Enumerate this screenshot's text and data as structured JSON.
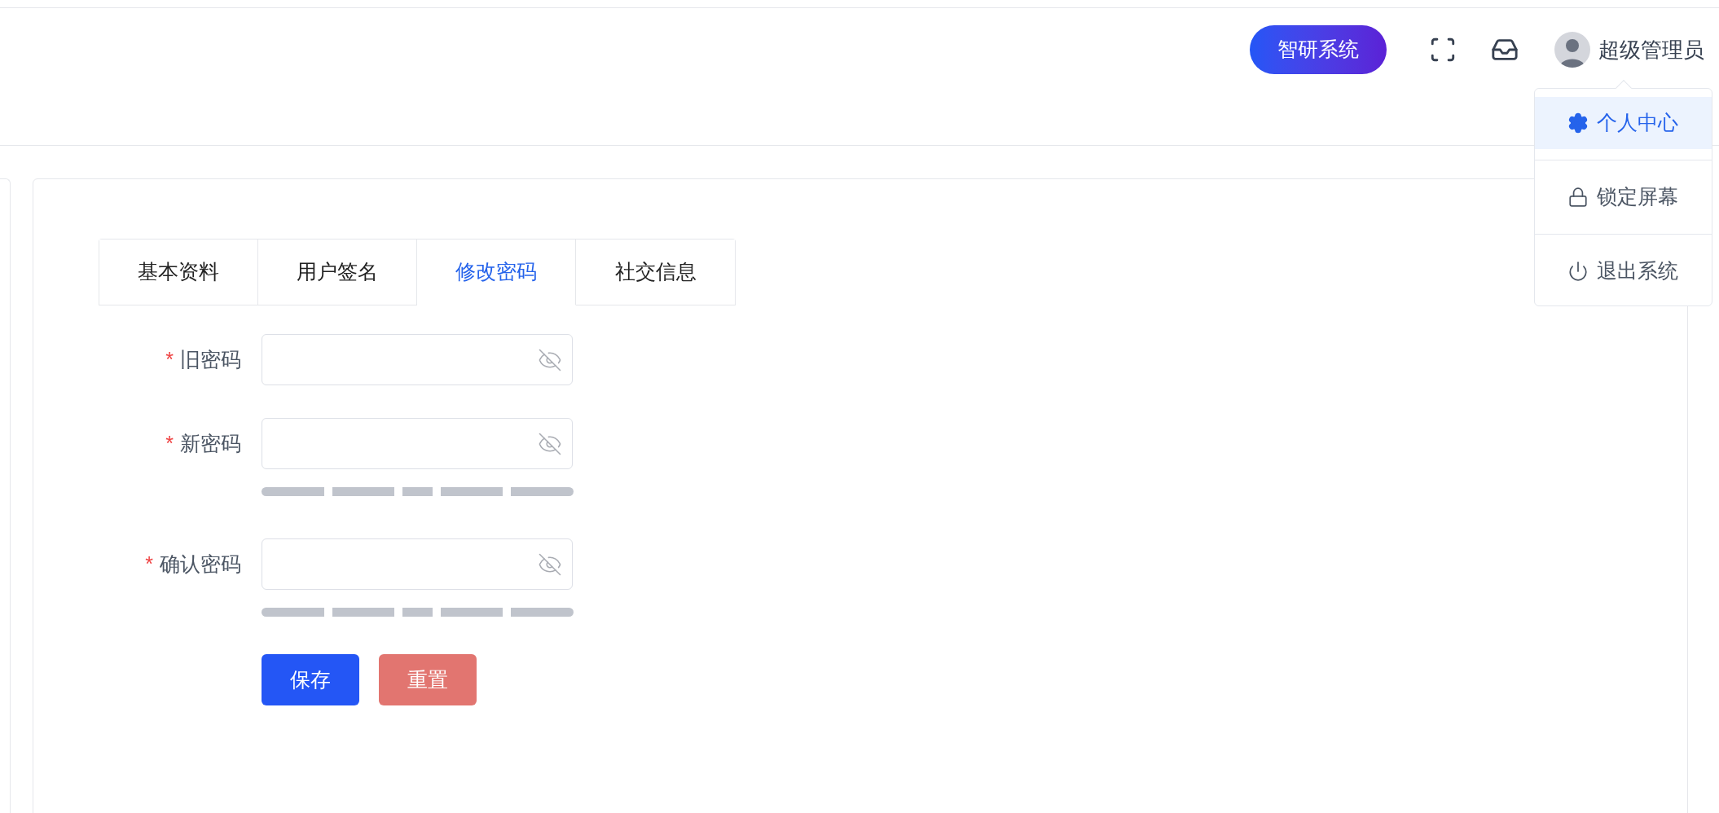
{
  "header": {
    "system_button": "智研系统",
    "user_name": "超级管理员"
  },
  "user_menu": {
    "items": [
      {
        "kind": "settings",
        "label": "个人中心",
        "selected": true
      },
      {
        "kind": "lock",
        "label": "锁定屏幕",
        "selected": false
      },
      {
        "kind": "power",
        "label": "退出系统",
        "selected": false
      }
    ]
  },
  "tabs": [
    {
      "label": "基本资料",
      "selected": false
    },
    {
      "label": "用户签名",
      "selected": false
    },
    {
      "label": "修改密码",
      "selected": true
    },
    {
      "label": "社交信息",
      "selected": false
    }
  ],
  "form": {
    "fields": [
      {
        "kind": "password",
        "label": "旧密码",
        "required_mark": "*"
      },
      {
        "kind": "password_with_strength",
        "label": "新密码",
        "required_mark": "*"
      },
      {
        "kind": "password_with_strength",
        "label": "确认密码",
        "required_mark": "*"
      }
    ],
    "buttons": [
      {
        "kind": "primary",
        "label": "保存"
      },
      {
        "kind": "danger",
        "label": "重置"
      }
    ]
  }
}
